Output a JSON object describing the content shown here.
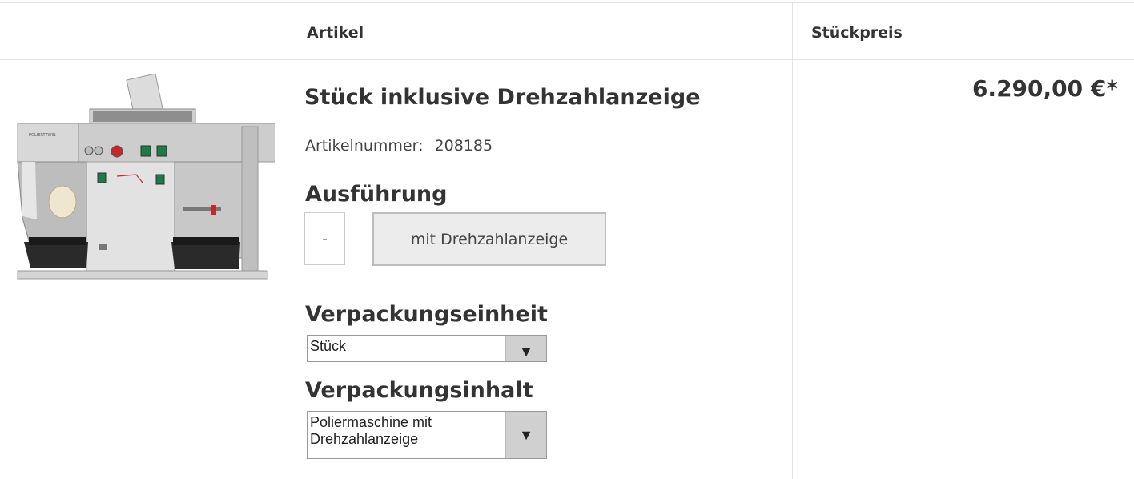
{
  "table_header": {
    "article": "Artikel",
    "unit_price": "Stückpreis"
  },
  "product": {
    "title": "Stück inklusive Drehzahlanzeige",
    "article_number_label": "Artikelnummer:",
    "article_number": "208185",
    "variant_heading": "Ausführung",
    "variant_options": [
      "-",
      "mit Drehzahlanzeige"
    ],
    "selected_variant": "mit Drehzahlanzeige",
    "packaging_unit_heading": "Verpackungseinheit",
    "packaging_unit_value": "Stück",
    "packaging_content_heading": "Verpackungsinhalt",
    "packaging_content_value_line1": "Poliermaschine mit",
    "packaging_content_value_line2": "Drehzahlanzeige",
    "price": "6.290,00 €*",
    "image_label": "POLIERTTWIN"
  },
  "icons": {
    "dropdown": "▼"
  },
  "colors": {
    "border": "#e3e3e3",
    "text": "#333333",
    "selected_bg": "#ececec",
    "dropdown_arrow_bg": "#d0d0d0"
  }
}
